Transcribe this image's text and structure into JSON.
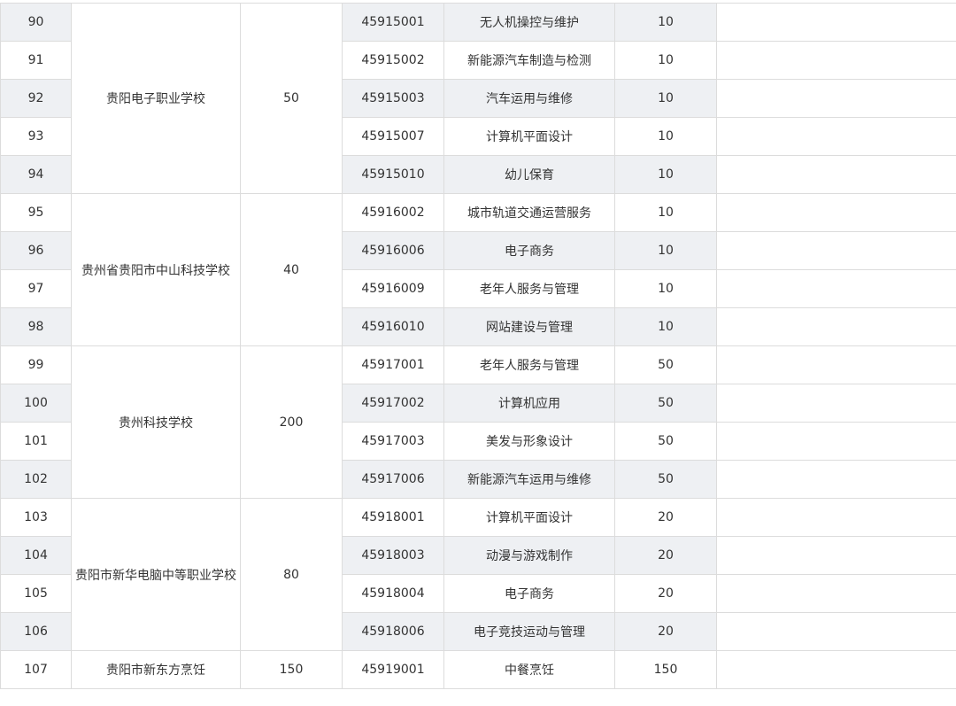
{
  "table": {
    "rows": [
      {
        "seq": "90",
        "code": "45915001",
        "major": "无人机操控与维护",
        "quota": "10"
      },
      {
        "seq": "91",
        "code": "45915002",
        "major": "新能源汽车制造与检测",
        "quota": "10"
      },
      {
        "seq": "92",
        "code": "45915003",
        "major": "汽车运用与维修",
        "quota": "10"
      },
      {
        "seq": "93",
        "code": "45915007",
        "major": "计算机平面设计",
        "quota": "10"
      },
      {
        "seq": "94",
        "code": "45915010",
        "major": "幼儿保育",
        "quota": "10"
      },
      {
        "seq": "95",
        "code": "45916002",
        "major": "城市轨道交通运营服务",
        "quota": "10"
      },
      {
        "seq": "96",
        "code": "45916006",
        "major": "电子商务",
        "quota": "10"
      },
      {
        "seq": "97",
        "code": "45916009",
        "major": "老年人服务与管理",
        "quota": "10"
      },
      {
        "seq": "98",
        "code": "45916010",
        "major": "网站建设与管理",
        "quota": "10"
      },
      {
        "seq": "99",
        "code": "45917001",
        "major": "老年人服务与管理",
        "quota": "50"
      },
      {
        "seq": "100",
        "code": "45917002",
        "major": "计算机应用",
        "quota": "50"
      },
      {
        "seq": "101",
        "code": "45917003",
        "major": "美发与形象设计",
        "quota": "50"
      },
      {
        "seq": "102",
        "code": "45917006",
        "major": "新能源汽车运用与维修",
        "quota": "50"
      },
      {
        "seq": "103",
        "code": "45918001",
        "major": "计算机平面设计",
        "quota": "20"
      },
      {
        "seq": "104",
        "code": "45918003",
        "major": "动漫与游戏制作",
        "quota": "20"
      },
      {
        "seq": "105",
        "code": "45918004",
        "major": "电子商务",
        "quota": "20"
      },
      {
        "seq": "106",
        "code": "45918006",
        "major": "电子竞技运动与管理",
        "quota": "20"
      },
      {
        "seq": "107",
        "code": "45919001",
        "major": "中餐烹饪",
        "quota": "150"
      }
    ],
    "schools": [
      {
        "name": "贵阳电子职业学校",
        "total": "50"
      },
      {
        "name": "贵州省贵阳市中山科技学校",
        "total": "40"
      },
      {
        "name": "贵州科技学校",
        "total": "200"
      },
      {
        "name": "贵阳市新华电脑中等职业学校",
        "total": "80"
      },
      {
        "name": "贵阳市新东方烹饪",
        "total": "150"
      }
    ]
  }
}
